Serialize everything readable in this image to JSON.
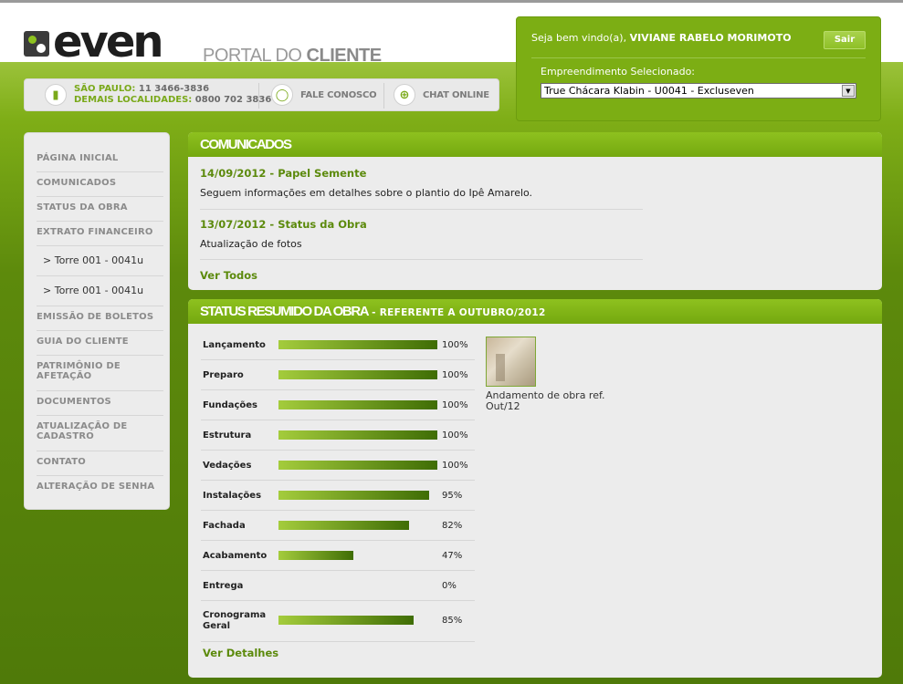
{
  "header": {
    "logo_text": "even",
    "portal_prefix": "PORTAL DO ",
    "portal_bold": "CLIENTE",
    "contact": {
      "sp_label": "SÃO PAULO:",
      "sp_phone": "11 3466-3836",
      "other_label": "DEMAIS LOCALIDADES:",
      "other_phone": "0800 702 3836",
      "contact_label": "FALE CONOSCO",
      "chat_label": "CHAT ONLINE"
    }
  },
  "user": {
    "greeting": "Seja bem vindo(a),",
    "name": "VIVIANE RABELO MORIMOTO",
    "logout": "Sair",
    "project_label": "Empreendimento Selecionado:",
    "project_value": "True Chácara Klabin - U0041 - Excluseven"
  },
  "sidebar": {
    "items": [
      {
        "label": "PÁGINA INICIAL"
      },
      {
        "label": "COMUNICADOS"
      },
      {
        "label": "STATUS DA OBRA"
      },
      {
        "label": "EXTRATO FINANCEIRO"
      },
      {
        "label": "> Torre 001 - 0041u"
      },
      {
        "label": "> Torre 001 - 0041u"
      },
      {
        "label": "EMISSÃO DE BOLETOS"
      },
      {
        "label": "GUIA DO CLIENTE"
      },
      {
        "label": "PATRIMÔNIO DE AFETAÇÃO"
      },
      {
        "label": "DOCUMENTOS"
      },
      {
        "label": "ATUALIZAÇÃO DE CADASTRO"
      },
      {
        "label": "CONTATO"
      },
      {
        "label": "ALTERAÇÃO DE SENHA"
      }
    ]
  },
  "communications": {
    "title": "COMUNICADOS",
    "items": [
      {
        "title": "14/09/2012 - Papel Semente",
        "body": "Seguem informações em detalhes sobre o plantio do Ipê Amarelo."
      },
      {
        "title": "13/07/2012 - Status da Obra",
        "body": "Atualização de fotos"
      }
    ],
    "see_all": "Ver Todos"
  },
  "status": {
    "title": "STATUS RESUMIDO DA OBRA",
    "subtitle": " - REFERENTE A OUTUBRO/2012",
    "rows": [
      {
        "label": "Lançamento",
        "pct_text": "100%",
        "pct": 100
      },
      {
        "label": "Preparo",
        "pct_text": "100%",
        "pct": 100
      },
      {
        "label": "Fundações",
        "pct_text": "100%",
        "pct": 100
      },
      {
        "label": "Estrutura",
        "pct_text": "100%",
        "pct": 100
      },
      {
        "label": "Vedações",
        "pct_text": "100%",
        "pct": 100
      },
      {
        "label": "Instalações",
        "pct_text": "95%",
        "pct": 95
      },
      {
        "label": "Fachada",
        "pct_text": "82%",
        "pct": 82
      },
      {
        "label": "Acabamento",
        "pct_text": "47%",
        "pct": 47
      },
      {
        "label": "Entrega",
        "pct_text": "0%",
        "pct": 0
      },
      {
        "label": "Cronograma Geral",
        "pct_text": "85%",
        "pct": 85
      }
    ],
    "photo_caption": "Andamento de obra ref. Out/12",
    "details": "Ver Detalhes"
  }
}
